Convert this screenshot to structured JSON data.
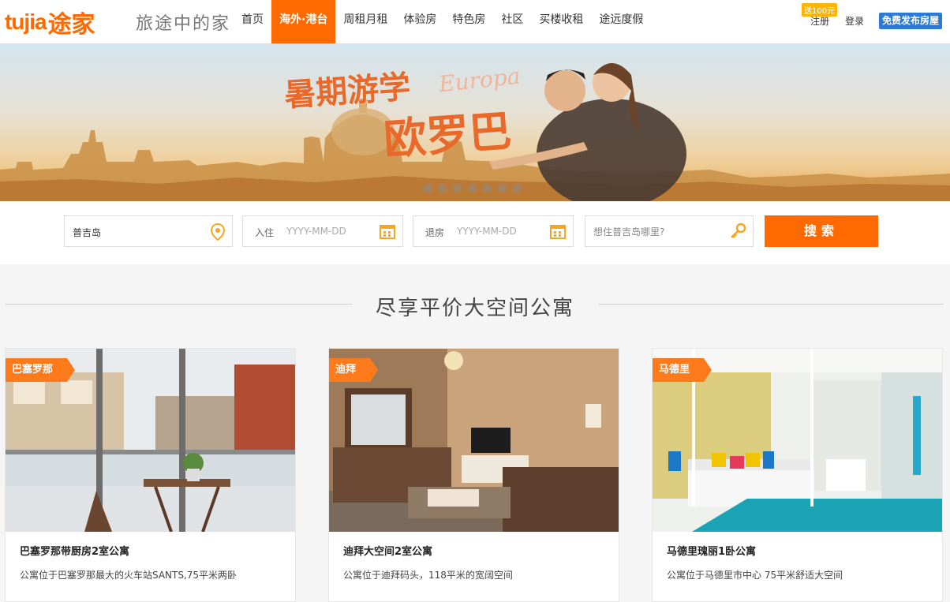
{
  "header": {
    "logo_latin": "tujia",
    "logo_cn": "途家",
    "slogan": "旅途中的家",
    "nav": [
      "首页",
      "海外·港台",
      "周租月租",
      "体验房",
      "特色房",
      "社区",
      "买楼收租",
      "途远度假"
    ],
    "active_nav": "海外·港台",
    "promo_badge": "送100元",
    "register": "注册",
    "login": "登录",
    "publish": "免费发布房屋"
  },
  "banner": {
    "title_line1": "暑期游学",
    "title_line2": "欧罗巴",
    "subtitle": "Europa",
    "slide_count": 7
  },
  "search": {
    "destination_value": "普吉岛",
    "checkin_label": "入住",
    "checkin_placeholder": "YYYY-MM-DD",
    "checkout_label": "退房",
    "checkout_placeholder": "YYYY-MM-DD",
    "keyword_placeholder": "想住普吉岛哪里?",
    "button": "搜索"
  },
  "section": {
    "title": "尽享平价大空间公寓"
  },
  "cards": [
    {
      "tag": "巴塞罗那",
      "name": "巴塞罗那带厨房2室公寓",
      "desc": "公寓位于巴塞罗那最大的火车站SANTS,75平米两卧"
    },
    {
      "tag": "迪拜",
      "name": "迪拜大空间2室公寓",
      "desc": "公寓位于迪拜码头，118平米的宽阔空间"
    },
    {
      "tag": "马德里",
      "name": "马德里瑰丽1卧公寓",
      "desc": "公寓位于马德里市中心 75平米舒适大空间"
    }
  ],
  "colors": {
    "brand": "#ff6a00",
    "publish_button": "#2c7ad6"
  },
  "icons": [
    "location-pin-icon",
    "calendar-icon",
    "key-icon"
  ]
}
